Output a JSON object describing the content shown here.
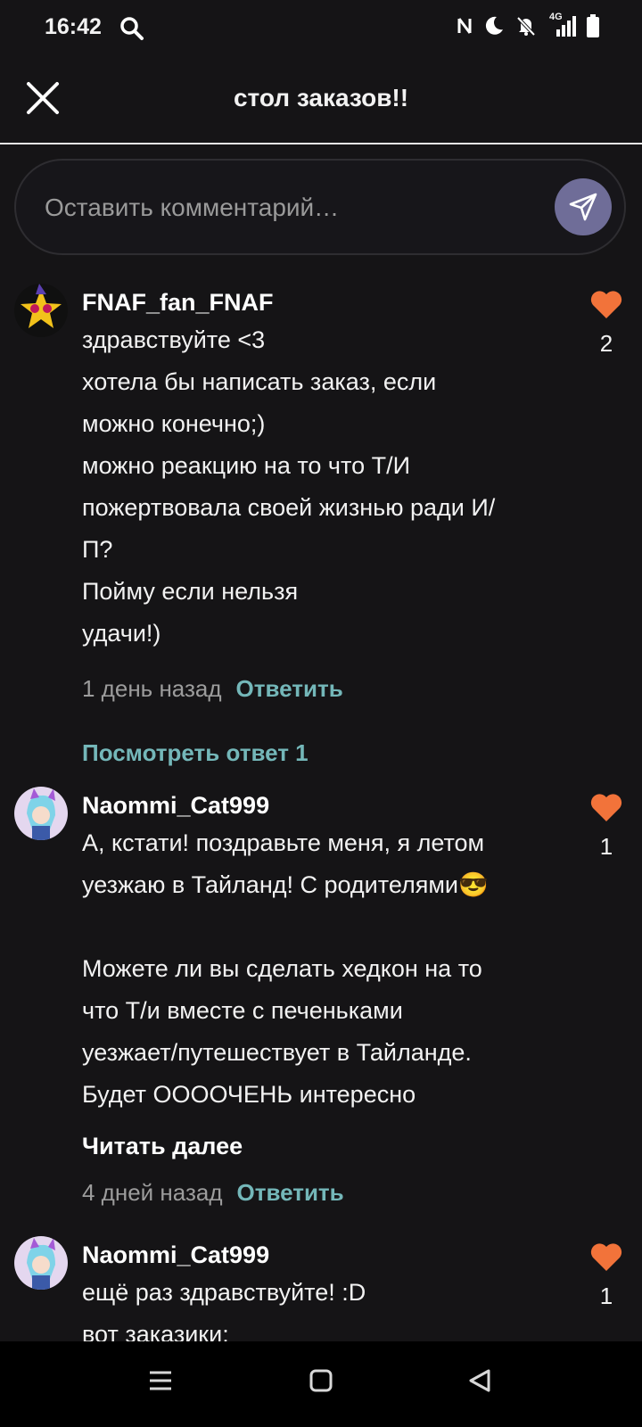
{
  "status_bar": {
    "time": "16:42",
    "network": "4G"
  },
  "header": {
    "title": "стол заказов!!"
  },
  "composer": {
    "placeholder": "Оставить комментарий…"
  },
  "comments": [
    {
      "author": "FNAF_fan_FNAF",
      "lines": [
        "здравствуйте <3",
        "хотела бы написать заказ, если",
        "можно конечно;)",
        "можно реакцию на то что Т/И",
        "пожертвовала своей жизнью ради И/",
        "П?",
        "Пойму если нельзя",
        "удачи!)"
      ],
      "likes": "2",
      "time": "1 день назад",
      "reply_label": "Ответить",
      "view_replies": "Посмотреть ответ 1"
    },
    {
      "author": "Naommi_Cat999",
      "lines": [
        "А, кстати! поздравьте меня, я летом",
        "уезжаю в Тайланд! С родителями😎",
        "",
        "Можете ли вы сделать хедкон на то",
        "что Т/и вместе с печеньками",
        "уезжает/путешествует в Тайланде.",
        "Будет ООООЧЕНЬ интересно"
      ],
      "read_more": "Читать далее",
      "likes": "1",
      "time": "4 дней назад",
      "reply_label": "Ответить"
    },
    {
      "author": "Naommi_Cat999",
      "lines": [
        "ещё раз здравствуйте! :D",
        "вот заказики:"
      ],
      "likes": "1"
    }
  ],
  "colors": {
    "background": "#151416",
    "accent_teal": "#74b7b9",
    "heart": "#f2733a",
    "send_button": "#6f6d98"
  }
}
